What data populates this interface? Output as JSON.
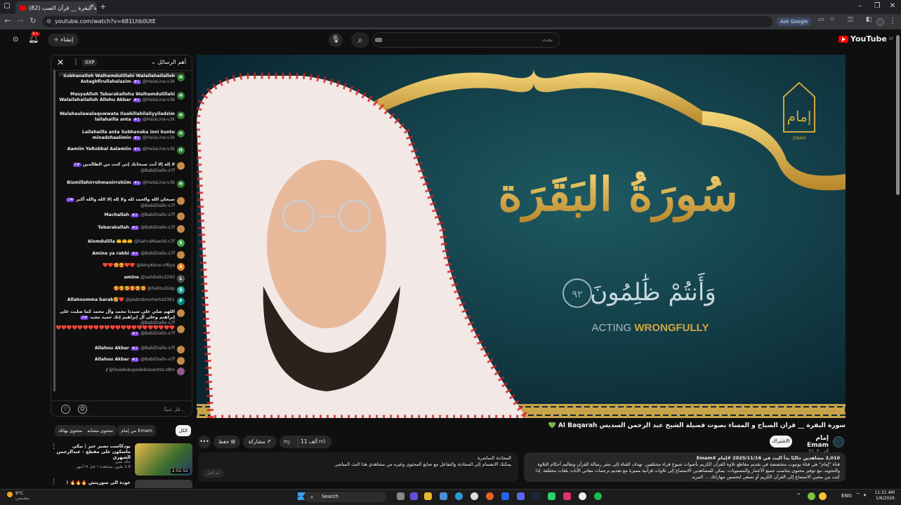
{
  "browser": {
    "tab_title": "(82) سورة البقرة __ قرآن الصب...",
    "url": "youtube.com/watch?v=681Lhb0UtE",
    "ask_google": "Ask Google"
  },
  "header": {
    "logo": "YouTube",
    "region": "ST",
    "search_placeholder": "بحث",
    "create_label": "إنشاء",
    "notification_count": "9+"
  },
  "chat": {
    "sort_label": "أهم الرسائل",
    "xp_badge": "0XP",
    "input_placeholder": "قل شيئًا...",
    "messages": [
      {
        "user": "@HalaLina-v3k",
        "badge": "#1",
        "avatar": "H",
        "color": "#2e7d32",
        "text": "Subhanalloh Walhamdulillahi Walailahailalloh Astaghfirullahalazim"
      },
      {
        "user": "@HalaLina-v3k",
        "badge": "#1",
        "avatar": "H",
        "color": "#2e7d32",
        "text": "MasyaAlloh Tabarakalloha Walhamdulillahi Walailahailalloh Allohu Akbar"
      },
      {
        "user": "@HalaLina-v3k",
        "badge": "#1",
        "avatar": "H",
        "color": "#2e7d32",
        "text": "Walahaulawalaquwwata Ilaabillahilaliyyiladzim lailahailla anta"
      },
      {
        "user": "@HalaLina-v3k",
        "badge": "#1",
        "avatar": "H",
        "color": "#2e7d32",
        "text": "Lailahailla anta Subhanaka inni kuntu minadzhaalimin"
      },
      {
        "user": "@HalaLina-v3k",
        "badge": "#1",
        "avatar": "H",
        "color": "#2e7d32",
        "text": "Aamiin YaRobbal Aalamiin"
      },
      {
        "user": "@BabiDiallo-s7f",
        "badge": "#2",
        "avatar": "",
        "color": "#c58a4a",
        "text": "لا إله إلا أنت سبحانك إني كنت من الظالمين"
      },
      {
        "user": "@HalaLina-v3k",
        "badge": "#1",
        "avatar": "H",
        "color": "#2e7d32",
        "text": "Bismillahirrohmanirrohiim"
      },
      {
        "user": "@BabiDiallo-s7f",
        "badge": "#2",
        "avatar": "",
        "color": "#c58a4a",
        "text": "سبحان الله والحمد لله ولا إله إلا الله والله أكبر"
      },
      {
        "user": "@BabiDiallo-s7f",
        "badge": "#2",
        "avatar": "",
        "color": "#c58a4a",
        "text": "Machallah"
      },
      {
        "user": "@BabiDiallo-s7f",
        "badge": "#2",
        "avatar": "",
        "color": "#c58a4a",
        "text": "Tabarakallah"
      },
      {
        "user": "@SahraMawlid-n7f",
        "badge": "",
        "avatar": "S",
        "color": "#43a047",
        "text": "Alxmdulilla 🤲🤲🤲"
      },
      {
        "user": "@BabiDiallo-s7f",
        "badge": "#2",
        "avatar": "",
        "color": "#c58a4a",
        "text": "Amine ya rabbi"
      },
      {
        "user": "@AmyKone-vf6yo",
        "badge": "",
        "avatar": "A",
        "color": "#e67e22",
        "text": "❤️❤️🥰🥰❤️❤️"
      },
      {
        "user": "@salidiallo3293",
        "badge": "",
        "avatar": "L",
        "color": "#555555",
        "text": "amine"
      },
      {
        "user": "@SallouDiop",
        "badge": "",
        "avatar": "S",
        "color": "#26a69a",
        "text": "🥰🥰🥰🥰🥰🥰"
      },
      {
        "user": "@pedrobournerta5361",
        "badge": "",
        "avatar": "P",
        "color": "#00897b",
        "text": "Allahoumma barak🥰❤️"
      },
      {
        "user": "@BabiDiallo-s7f",
        "badge": "#2",
        "avatar": "",
        "color": "#c58a4a",
        "text": "اللهم صلي على سيدنا محمد وآل محمد كما صليت على إبراهيم وعلى آل إبراهيم إنك حميد مجيد"
      },
      {
        "user": "@BabiDiallo-s7f",
        "badge": "#2",
        "avatar": "",
        "color": "#c58a4a",
        "text": "❤️❤️❤️❤️❤️❤️❤️❤️❤️❤️❤️❤️❤️❤️❤️❤️❤️❤️❤️❤️❤️❤️"
      },
      {
        "user": "@BabiDiallo-s7f",
        "badge": "#2",
        "avatar": "",
        "color": "#c58a4a",
        "text": "Allahou Akbar"
      },
      {
        "user": "@BabiDiallo-s7f",
        "badge": "#2",
        "avatar": "",
        "color": "#c58a4a",
        "text": "Allahou Akbar"
      },
      {
        "user": "@Ouadukupedelossantos-z8m",
        "badge": "",
        "avatar": "",
        "color": "#8e5a8a",
        "text": "/"
      }
    ]
  },
  "video": {
    "title_ar": "سُورَةُ البَقَرَة",
    "verse_ar": "وَأَنتُمْ ظَٰلِمُونَ",
    "verse_num": "٩٢",
    "subtitle_a": "ACTING ",
    "subtitle_b": "WRONGFULLY",
    "logo_ar": "إمام",
    "logo_en": "EMAM"
  },
  "info": {
    "title": "سورة البقرة __ قرآن الصباح و المساء بصوت فضيلة الشيخ عبد الرحمن السديس AlSudais 💚 Al Baqarah",
    "channel": "إمام Emam",
    "subs": "21.7 ألف مشترك",
    "subscribe": "الاشتراك",
    "likes": "11 ألف",
    "share": "مشاركة",
    "save": "حفظ",
    "more": "•••"
  },
  "description": {
    "stats": "2,010 مشاهدين حاليًا بدأ البث في 2025/11/16 #إمام #Emam",
    "text": "قناة \"إمام\" هي قناة يوتيوب متخصصة في تقديم مقاطع تلاوة القرآن الكريم بأصوات شيوخ قراء مختلفين. تهدف القناة إلى نشر رسالة القرآن وتعاليم أحكام التلاوة والتجويد، مع توفير محتوى يتناسب جميع الأعمار والمستويات. يمكن للمشاهدين الاستماع إلى تلاوات قرآنية مميزة مع تقديم ترجمات معاني الآيات بلغات مختلفة. إذا كنت من محبي الاستماع إلى القرآن الكريم أو تسعى لتحسين مهاراتك ... المزيد"
  },
  "livechat_notice": {
    "title": "المحادثة المباشرة",
    "text": "يمكنك الانضمام إلى المحادثة والتفاعل مع صانع المحتوى وغيره من مشاهدي هذا البث المباشر.",
    "button": "لم أقبل"
  },
  "recs": {
    "chips": [
      "الكل",
      "من إمام Emam",
      "محتوى مشابه",
      "محتوى بهاتك"
    ],
    "item1": {
      "title": "بودكاست نصير خير | نيكي ماسكون على مقطع - عبدالرحمن الشهري",
      "channel": "خالد نصير",
      "meta": "2.8 مليون مشاهدة • قبل 4 أشهر",
      "duration": "2:02:52"
    },
    "item2": {
      "title": "عودة الى سوريتش 🔥🔥🔥 !"
    }
  },
  "taskbar": {
    "search": "Search",
    "time": "11:31 AM",
    "date": "1/6/2026",
    "lang": "ENG",
    "temp": "9°C",
    "weather": "مشمس"
  }
}
